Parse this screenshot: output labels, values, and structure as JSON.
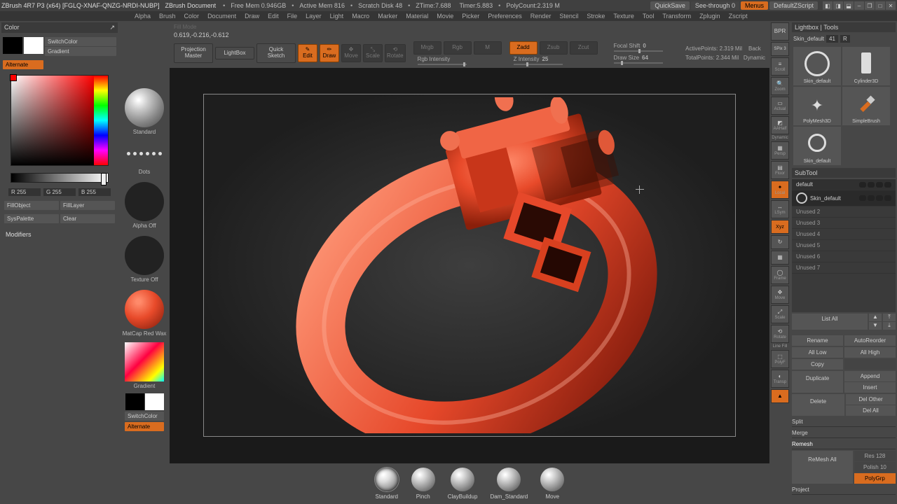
{
  "title": {
    "app": "ZBrush 4R7 P3 (x64) [FGLQ-XNAF-QNZG-NRDI-NUBP]",
    "doc": "ZBrush Document",
    "freemem": "Free Mem 0.946GB",
    "activemem": "Active Mem 816",
    "scratch": "Scratch Disk 48",
    "ztime": "ZTime:7.688",
    "timer": "Timer:5.883",
    "polycount": "PolyCount:2.319 M",
    "quicksave": "QuickSave",
    "seethrough": "See-through 0",
    "menus": "Menus",
    "script": "DefaultZScript"
  },
  "menu": [
    "Alpha",
    "Brush",
    "Color",
    "Document",
    "Draw",
    "Edit",
    "File",
    "Layer",
    "Light",
    "Macro",
    "Marker",
    "Material",
    "Movie",
    "Picker",
    "Preferences",
    "Render",
    "Stencil",
    "Stroke",
    "Texture",
    "Tool",
    "Transform",
    "Zplugin",
    "Zscript"
  ],
  "left": {
    "panel": "Color",
    "switch": "SwitchColor",
    "gradient": "Gradient",
    "alternate": "Alternate",
    "r": "R 255",
    "g": "G 255",
    "b": "B 255",
    "fillobj": "FillObject",
    "filllayer": "FillLayer",
    "syspal": "SysPalette",
    "clear": "Clear",
    "modifiers": "Modifiers"
  },
  "brushcol": {
    "standard": "Standard",
    "dots": "Dots",
    "alphaoff": "Alpha Off",
    "texoff": "Texture Off",
    "matcap": "MatCap Red Wax",
    "gradient": "Gradient",
    "switch": "SwitchColor",
    "alternate": "Alternate",
    "fillmode": "Fill Mode"
  },
  "center": {
    "coords": "0.619,-0.216,-0.612",
    "projmaster": "Projection\nMaster",
    "lightbox": "LightBox",
    "quicksketch": "Quick\nSketch",
    "edit": "Edit",
    "draw": "Draw",
    "move": "Move",
    "scale": "Scale",
    "rotate": "Rotate",
    "mrgb": "Mrgb",
    "rgb": "Rgb",
    "m": "M",
    "rgbint": "Rgb Intensity",
    "zadd": "Zadd",
    "zsub": "Zsub",
    "zcut": "Zcut",
    "zint": "Z Intensity",
    "zintval": "25",
    "focal": "Focal Shift",
    "focalval": "0",
    "drawsize": "Draw Size",
    "drawsizeval": "64",
    "active": "ActivePoints: 2.319 Mil",
    "total": "TotalPoints: 2.344 Mil",
    "back": "Back",
    "dynamic": "Dynamic"
  },
  "shelf": [
    "Standard",
    "Pinch",
    "ClayBuildup",
    "Dam_Standard",
    "Move"
  ],
  "nav": {
    "bpr": "BPR",
    "spix": "SPix 3",
    "scroll": "Scroll",
    "zoom": "Zoom",
    "actual": "Actual",
    "aahalf": "AAHalf",
    "persp": "Persp",
    "floor": "Floor",
    "local": "Local",
    "lsym": "LSym",
    "xyz": "Xyz",
    "frame": "Frame",
    "move": "Move",
    "scale": "Scale",
    "rotate": "Rotate",
    "polyf": "PolyF",
    "transp": "Transp",
    "dynamic": "Dynamic"
  },
  "right": {
    "lightbox": "Lightbox | Tools",
    "skindef": "Skin_default",
    "skindefnum": "41",
    "r": "R",
    "tools": [
      "Skin_default",
      "Cylinder3D",
      "PolyMesh3D",
      "SimpleBrush",
      "Skin_default"
    ],
    "subtool": "SubTool",
    "default": "default",
    "skdef": "Skin_default",
    "unused": [
      "Unused 2",
      "Unused 3",
      "Unused 4",
      "Unused 5",
      "Unused 6",
      "Unused 7"
    ],
    "listall": "List All",
    "rename": "Rename",
    "autoreorder": "AutoReorder",
    "alllow": "All Low",
    "allhigh": "All High",
    "copy": "Copy",
    "duplicate": "Duplicate",
    "append": "Append",
    "insert": "Insert",
    "delete": "Delete",
    "delother": "Del Other",
    "delall": "Del All",
    "split": "Split",
    "merge": "Merge",
    "remesh": "Remesh",
    "remeshall": "ReMesh All",
    "res": "Res 128",
    "polish": "Polish 10",
    "polygrp": "PolyGrp",
    "project": "Project"
  }
}
